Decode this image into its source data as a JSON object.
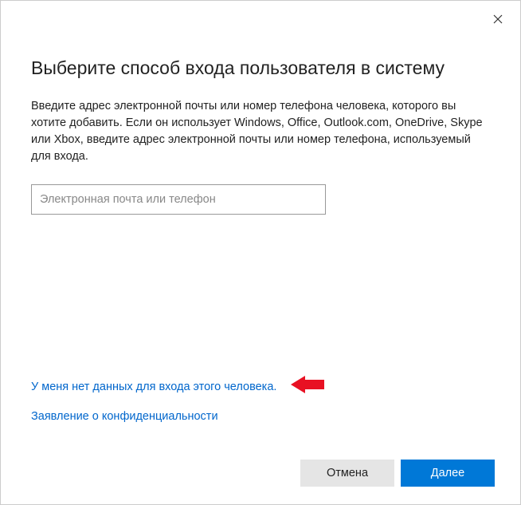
{
  "dialog": {
    "title": "Выберите способ входа пользователя в систему",
    "description": "Введите адрес электронной почты или номер телефона человека, которого вы хотите добавить. Если он использует Windows, Office, Outlook.com, OneDrive, Skype или Xbox, введите адрес электронной почты или номер телефона, используемый для входа.",
    "input": {
      "placeholder": "Электронная почта или телефон",
      "value": ""
    },
    "links": {
      "no_signin_info": "У меня нет данных для входа этого человека.",
      "privacy": "Заявление о конфиденциальности"
    },
    "buttons": {
      "cancel": "Отмена",
      "next": "Далее"
    },
    "annotation": {
      "arrow_color": "#e81123"
    }
  }
}
